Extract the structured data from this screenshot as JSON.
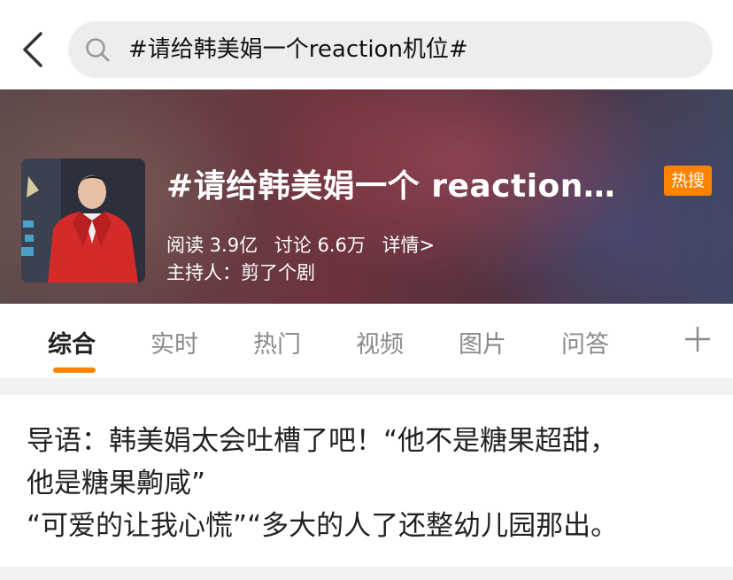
{
  "search": {
    "query": "#请给韩美娟一个reaction机位#"
  },
  "topic": {
    "title": "#请给韩美娟一个 reaction…",
    "badge": "热搜",
    "reads": "阅读 3.9亿",
    "discussions": "讨论 6.6万",
    "details": "详情>",
    "host": "主持人：剪了个剧"
  },
  "tabs": [
    "综合",
    "实时",
    "热门",
    "视频",
    "图片",
    "问答"
  ],
  "active_tab": "综合",
  "intro": {
    "line1": "导语：韩美娟太会吐槽了吧！“他不是糖果超甜，",
    "line2": "他是糖果齁咸”",
    "line3": "“可爱的让我心慌”“多大的人了还整幼儿园那出。"
  },
  "colors": {
    "accent": "#ff8200",
    "tab_inactive": "#8a8a8a",
    "search_bg": "#ededed"
  },
  "icons": [
    "back-arrow-icon",
    "search-icon",
    "plus-icon"
  ]
}
